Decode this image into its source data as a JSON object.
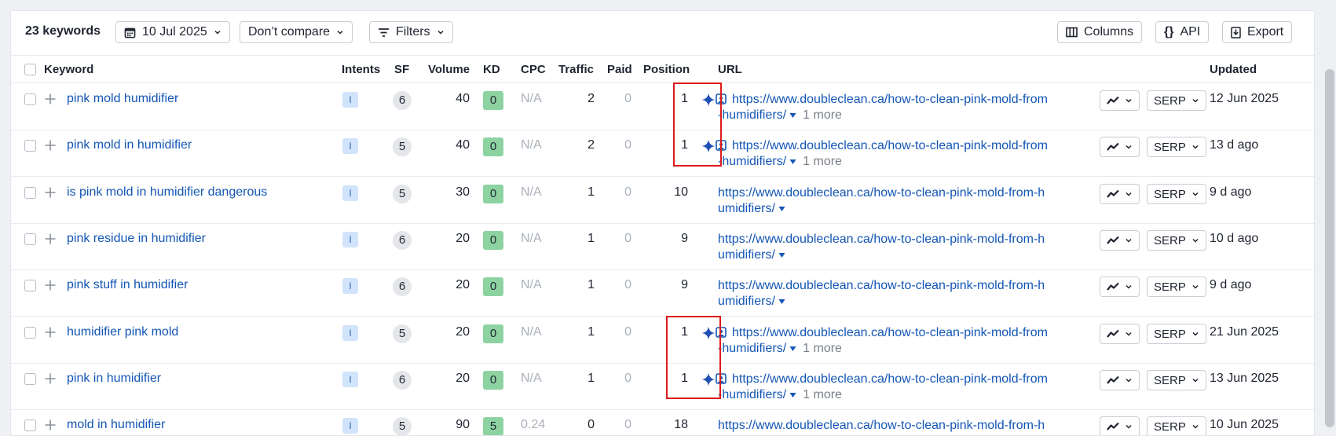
{
  "toolbar": {
    "count": "23 keywords",
    "date": "10 Jul 2025",
    "compare": "Don’t compare",
    "filters": "Filters",
    "columns": "Columns",
    "api": "API",
    "export": "Export"
  },
  "headers": {
    "keyword": "Keyword",
    "intents": "Intents",
    "sf": "SF",
    "volume": "Volume",
    "kd": "KD",
    "cpc": "CPC",
    "traffic": "Traffic",
    "paid": "Paid",
    "position": "Position",
    "url": "URL",
    "updated": "Updated"
  },
  "rows": [
    {
      "keyword": "pink mold humidifier",
      "intent": "I",
      "sf": "6",
      "volume": "40",
      "kd": "0",
      "cpc": "N/A",
      "traffic": "2",
      "paid": "0",
      "position": "1",
      "ai": true,
      "url_line1": "https://www.doubleclean.ca/how-to-clean-pink-mold-from",
      "url_line2": "-humidifiers/",
      "more": "1 more",
      "serp": "SERP",
      "updated": "12 Jun 2025"
    },
    {
      "keyword": "pink mold in humidifier",
      "intent": "I",
      "sf": "5",
      "volume": "40",
      "kd": "0",
      "cpc": "N/A",
      "traffic": "2",
      "paid": "0",
      "position": "1",
      "ai": true,
      "url_line1": "https://www.doubleclean.ca/how-to-clean-pink-mold-from",
      "url_line2": "-humidifiers/",
      "more": "1 more",
      "serp": "SERP",
      "updated": "13 d ago"
    },
    {
      "keyword": "is pink mold in humidifier dangerous",
      "intent": "I",
      "sf": "5",
      "volume": "30",
      "kd": "0",
      "cpc": "N/A",
      "traffic": "1",
      "paid": "0",
      "position": "10",
      "ai": false,
      "url_line1": "https://www.doubleclean.ca/how-to-clean-pink-mold-from-h",
      "url_line2": "umidifiers/",
      "more": "",
      "serp": "SERP",
      "updated": "9 d ago"
    },
    {
      "keyword": "pink residue in humidifier",
      "intent": "I",
      "sf": "6",
      "volume": "20",
      "kd": "0",
      "cpc": "N/A",
      "traffic": "1",
      "paid": "0",
      "position": "9",
      "ai": false,
      "url_line1": "https://www.doubleclean.ca/how-to-clean-pink-mold-from-h",
      "url_line2": "umidifiers/",
      "more": "",
      "serp": "SERP",
      "updated": "10 d ago"
    },
    {
      "keyword": "pink stuff in humidifier",
      "intent": "I",
      "sf": "6",
      "volume": "20",
      "kd": "0",
      "cpc": "N/A",
      "traffic": "1",
      "paid": "0",
      "position": "9",
      "ai": false,
      "url_line1": "https://www.doubleclean.ca/how-to-clean-pink-mold-from-h",
      "url_line2": "umidifiers/",
      "more": "",
      "serp": "SERP",
      "updated": "9 d ago"
    },
    {
      "keyword": "humidifier pink mold",
      "intent": "I",
      "sf": "5",
      "volume": "20",
      "kd": "0",
      "cpc": "N/A",
      "traffic": "1",
      "paid": "0",
      "position": "1",
      "ai": true,
      "url_line1": "https://www.doubleclean.ca/how-to-clean-pink-mold-from",
      "url_line2": "-humidifiers/",
      "more": "1 more",
      "serp": "SERP",
      "updated": "21 Jun 2025"
    },
    {
      "keyword": "pink in humidifier",
      "intent": "I",
      "sf": "6",
      "volume": "20",
      "kd": "0",
      "cpc": "N/A",
      "traffic": "1",
      "paid": "0",
      "position": "1",
      "ai": true,
      "url_line1": "https://www.doubleclean.ca/how-to-clean-pink-mold-from",
      "url_line2": "-humidifiers/",
      "more": "1 more",
      "serp": "SERP",
      "updated": "13 Jun 2025"
    },
    {
      "keyword": "mold in humidifier",
      "intent": "I",
      "sf": "5",
      "volume": "90",
      "kd": "5",
      "cpc": "0.24",
      "traffic": "0",
      "paid": "0",
      "position": "18",
      "ai": false,
      "url_line1": "https://www.doubleclean.ca/how-to-clean-pink-mold-from-h",
      "url_line2": "",
      "more": "",
      "serp": "SERP",
      "updated": "10 Jun 2025"
    }
  ],
  "colors": {
    "link": "#1356b5",
    "kd_badge": "#8dd3a2",
    "intent_badge": "#d1e4fb",
    "highlight": "#dd1a1a",
    "ai_spark": "#1f4fb5"
  }
}
